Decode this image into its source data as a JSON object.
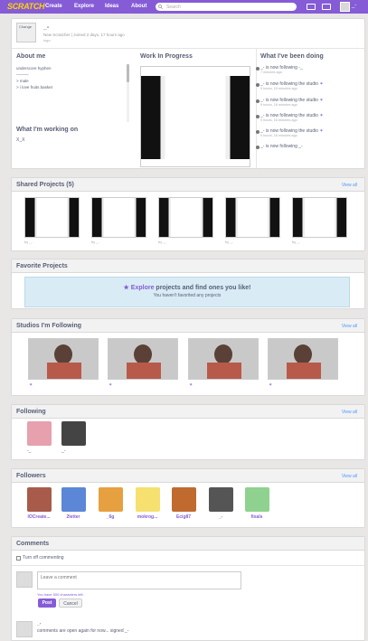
{
  "nav": {
    "logo": "SCRATCH",
    "create": "Create",
    "explore": "Explore",
    "ideas": "Ideas",
    "about": "About",
    "search_placeholder": "Search",
    "user": "_-"
  },
  "profile": {
    "avatar_label": "Change",
    "username": "_-",
    "role": "New Scratcher",
    "joined": "Joined 2 days, 17 hours ago",
    "location": "logo"
  },
  "about": {
    "title": "About me",
    "lines": [
      "underscore hyphen",
      "———",
      "> male",
      "> i love fruits basket"
    ],
    "working_title": "What I'm working on",
    "working_text": "X_X"
  },
  "wip": {
    "title": "Work In Progress"
  },
  "activity": {
    "title": "What I've been doing",
    "items": [
      {
        "text": "_- is now following -_",
        "time": "7 minutes ago"
      },
      {
        "text": "_- is now following the studio",
        "time": "9 hours, 15 minutes ago"
      },
      {
        "text": "_- is now following the studio",
        "time": "9 hours, 16 minutes ago"
      },
      {
        "text": "_- is now following the studio",
        "time": "9 hours, 16 minutes ago"
      },
      {
        "text": "_- is now following the studio",
        "time": "9 hours, 16 minutes ago"
      },
      {
        "text": "_- is now following _-",
        "time": ""
      }
    ]
  },
  "shared": {
    "title": "Shared Projects (5)",
    "view_all": "View all",
    "by": [
      "by _-",
      "by _-",
      "by _-",
      "by _-",
      "by _-"
    ]
  },
  "favorites": {
    "title": "Favorite Projects",
    "empty_link": "Explore",
    "empty_rest": " projects and find ones you like!",
    "empty_sub": "You haven't favorited any projects"
  },
  "studios": {
    "title": "Studios I'm Following",
    "view_all": "View all"
  },
  "following": {
    "title": "Following",
    "view_all": "View all",
    "users": [
      "-_",
      "_-"
    ]
  },
  "followers": {
    "title": "Followers",
    "view_all": "View all",
    "users": [
      "lOCreate...",
      "2letter",
      "_6g",
      "mokrog...",
      "Ecig87",
      "_-",
      "fixals"
    ]
  },
  "comments": {
    "title": "Comments",
    "turn_off": "Turn off commenting",
    "placeholder": "Leave a comment",
    "chars_left": "You have 500 characters left.",
    "post": "Post",
    "cancel": "Cancel",
    "comment_user": "_-",
    "comment_text": "comments are open again for now... signed _-"
  }
}
